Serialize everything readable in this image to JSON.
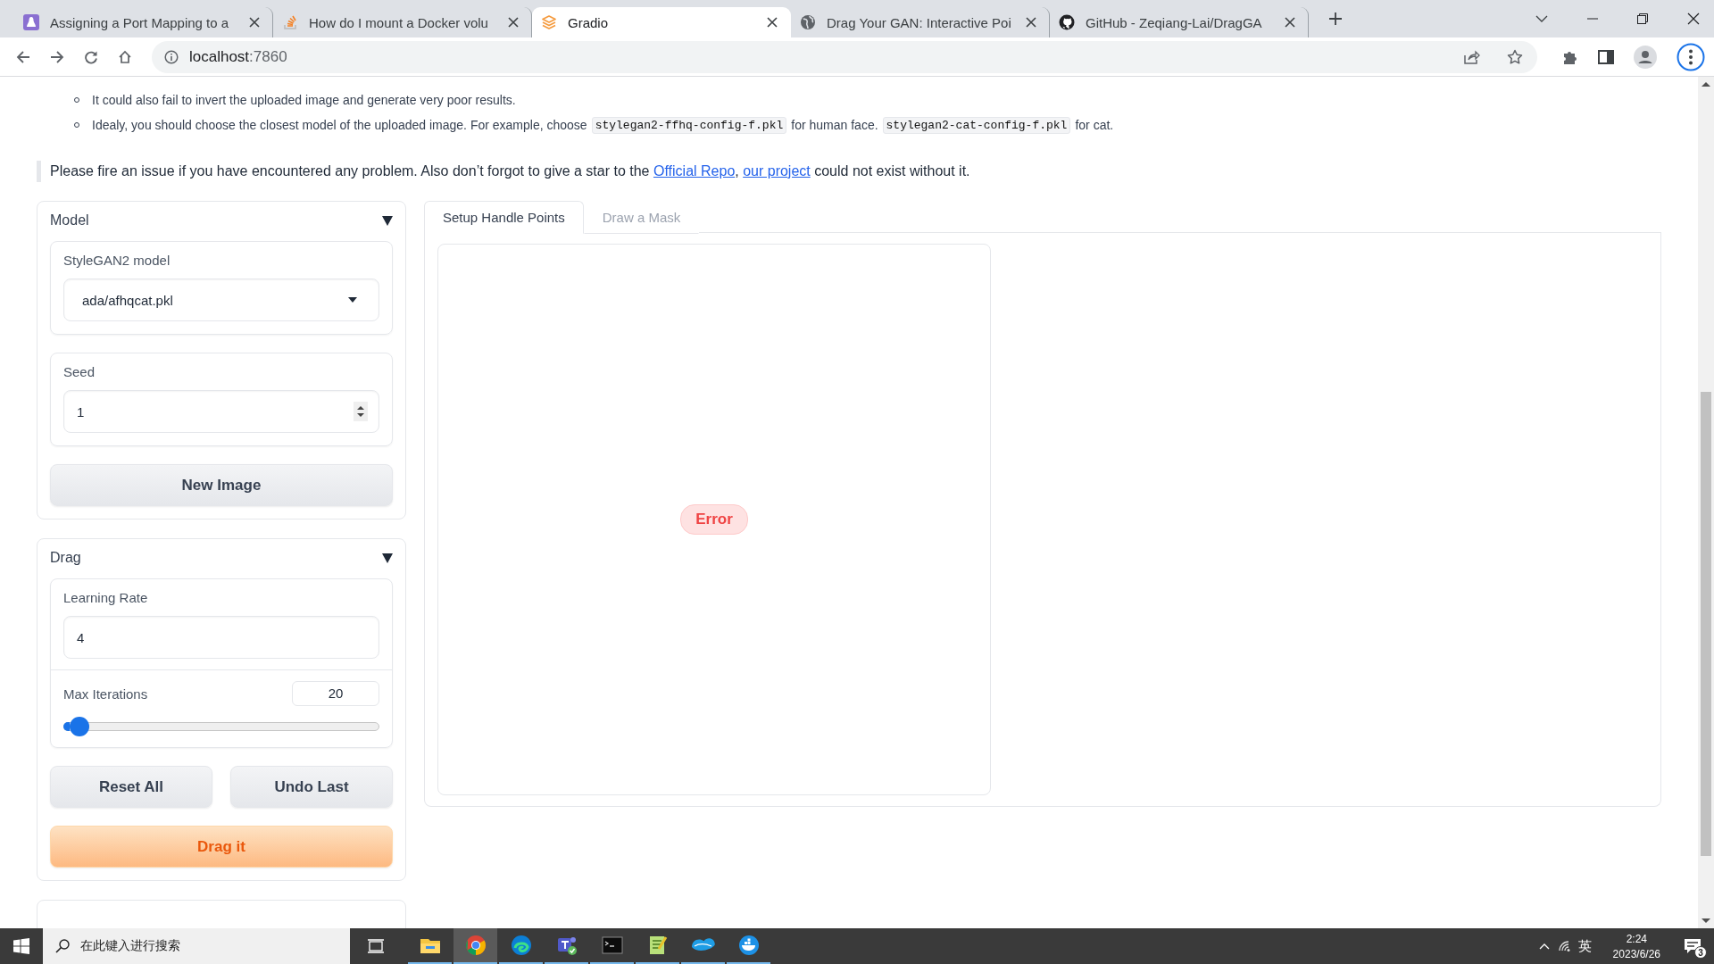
{
  "browser": {
    "tabs": [
      {
        "title": "Assigning a Port Mapping to a",
        "selected": false
      },
      {
        "title": "How do I mount a Docker volu",
        "selected": false
      },
      {
        "title": "Gradio",
        "selected": true
      },
      {
        "title": "Drag Your GAN: Interactive Poi",
        "selected": false
      },
      {
        "title": "GitHub - Zeqiang-Lai/DragGA",
        "selected": false
      }
    ],
    "address": {
      "host": "localhost",
      "port": ":7860"
    }
  },
  "page": {
    "notes": [
      {
        "parts": [
          {
            "kind": "text",
            "text": "It could also fail to invert the uploaded image and generate very poor results."
          }
        ]
      },
      {
        "parts": [
          {
            "kind": "text",
            "text": "Idealy, you should choose the closest model of the uploaded image. For example, choose"
          },
          {
            "kind": "code",
            "text": "stylegan2-ffhq-config-f.pkl"
          },
          {
            "kind": "text",
            "text": "for human face."
          },
          {
            "kind": "code",
            "text": "stylegan2-cat-config-f.pkl"
          },
          {
            "kind": "text",
            "text": "for cat."
          }
        ]
      }
    ],
    "notice": [
      {
        "kind": "text",
        "text": "Please fire an issue if you have encountered any problem. Also don’t forgot to give a star to the "
      },
      {
        "kind": "link",
        "text": "Official Repo"
      },
      {
        "kind": "text",
        "text": ", "
      },
      {
        "kind": "link",
        "text": "our project"
      },
      {
        "kind": "text",
        "text": " could not exist without it."
      }
    ],
    "model_panel": {
      "title": "Model",
      "expanded": true,
      "model_label": "StyleGAN2 model",
      "model_value": "ada/afhqcat.pkl",
      "seed_label": "Seed",
      "seed_value": "1",
      "button": "New Image"
    },
    "drag_panel": {
      "title": "Drag",
      "expanded": true,
      "lr_label": "Learning Rate",
      "lr_value": "4",
      "iter_label": "Max Iterations",
      "iter_value": "20",
      "level": 0.05,
      "buttons": [
        "Reset All",
        "Undo Last"
      ],
      "primary_button": "Drag it"
    },
    "image_tabs": [
      {
        "label": "Setup Handle Points",
        "selected": true
      },
      {
        "label": "Draw a Mask",
        "selected": false
      }
    ],
    "image_status": "Error"
  },
  "taskbar": {
    "search_placeholder": "在此键入进行搜索",
    "apps": [
      {
        "selected": false
      },
      {
        "selected": true
      },
      {
        "selected": false
      },
      {
        "selected": false
      },
      {
        "selected": false
      },
      {
        "selected": false
      },
      {
        "selected": false
      },
      {
        "selected": false
      }
    ],
    "ime": "英",
    "time": "2:24",
    "date": "2023/6/26",
    "notifications": "3"
  }
}
